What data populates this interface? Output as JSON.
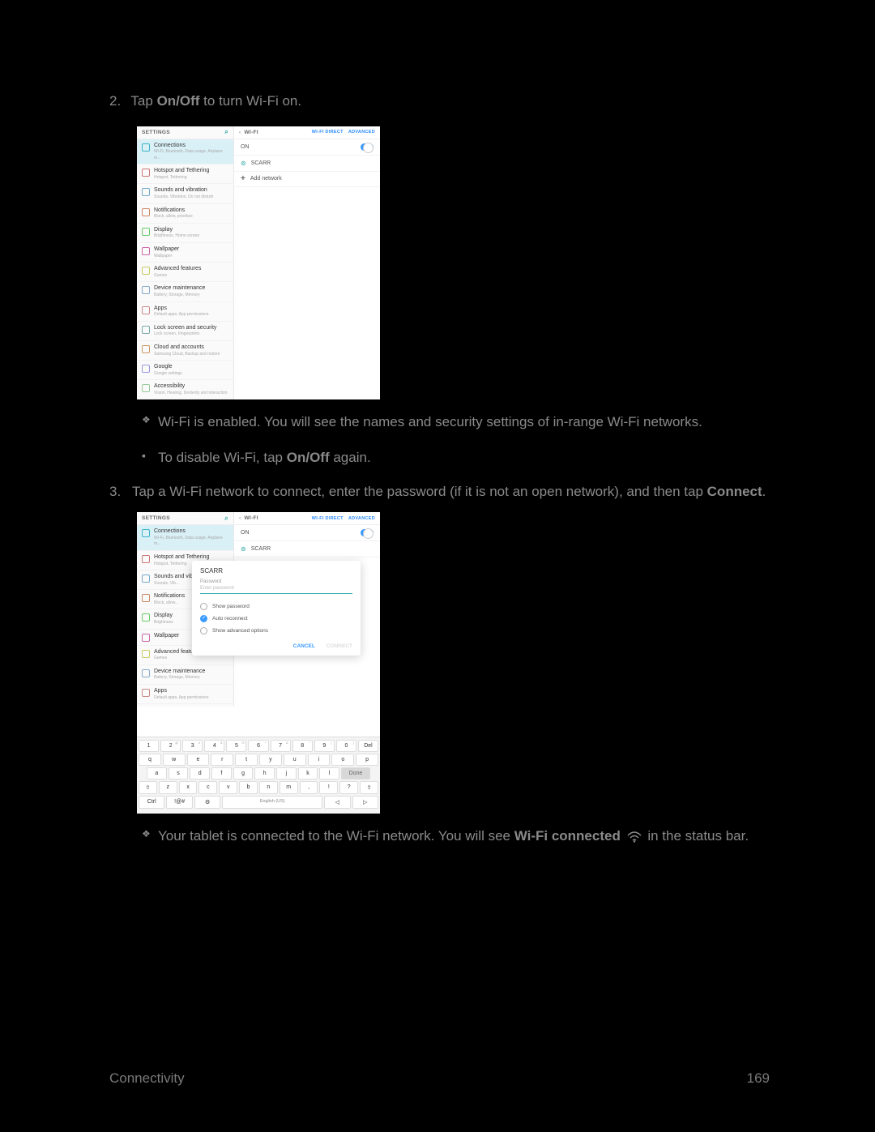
{
  "step2": {
    "num": "2.",
    "pre": "Tap ",
    "bold": "On/Off",
    "post": " to turn Wi-Fi on."
  },
  "bullet1": "Wi-Fi is enabled. You will see the names and security settings of in-range Wi-Fi networks.",
  "bullet2": {
    "pre": "To disable Wi-Fi, tap ",
    "bold": "On/Off",
    "post": " again."
  },
  "step3": {
    "num": "3.",
    "pre": "Tap a Wi-Fi network to connect, enter the password (if it is not an open network), and then tap ",
    "bold": "Connect",
    "post": "."
  },
  "bullet3": {
    "pre": "Your tablet is connected to the Wi-Fi network. You will see ",
    "bold": "Wi-Fi connected",
    "post": " in the status bar."
  },
  "footer": {
    "left": "Connectivity",
    "right": "169"
  },
  "shot": {
    "leftHeader": "SETTINGS",
    "rightHeader": {
      "back": "‹",
      "title": "WI-FI",
      "direct": "Wi-Fi Direct",
      "adv": "ADVANCED"
    },
    "items": [
      {
        "t": "Connections",
        "d": "Wi-Fi, Bluetooth, Data usage, Airplane m...",
        "c": "c-conn",
        "active": true
      },
      {
        "t": "Hotspot and Tethering",
        "d": "Hotspot, Tethering",
        "c": "c-hot"
      },
      {
        "t": "Sounds and vibration",
        "d": "Sounds, Vibration, Do not disturb",
        "c": "c-snd"
      },
      {
        "t": "Notifications",
        "d": "Block, allow, prioritize",
        "c": "c-not"
      },
      {
        "t": "Display",
        "d": "Brightness, Home screen",
        "c": "c-dsp"
      },
      {
        "t": "Wallpaper",
        "d": "Wallpaper",
        "c": "c-wal"
      },
      {
        "t": "Advanced features",
        "d": "Games",
        "c": "c-adv"
      },
      {
        "t": "Device maintenance",
        "d": "Battery, Storage, Memory",
        "c": "c-dev"
      },
      {
        "t": "Apps",
        "d": "Default apps, App permissions",
        "c": "c-app"
      },
      {
        "t": "Lock screen and security",
        "d": "Lock screen, Fingerprints",
        "c": "c-lck"
      },
      {
        "t": "Cloud and accounts",
        "d": "Samsung Cloud, Backup and restore",
        "c": "c-cld"
      },
      {
        "t": "Google",
        "d": "Google settings",
        "c": "c-ggl"
      },
      {
        "t": "Accessibility",
        "d": "Vision, Hearing, Dexterity and interaction",
        "c": "c-acc"
      }
    ],
    "on": "ON",
    "net": "SCARR",
    "add": "Add network"
  },
  "shot2items": [
    {
      "t": "Connections",
      "d": "Wi-Fi, Bluetooth, Data usage, Airplane m...",
      "c": "c-conn",
      "active": true
    },
    {
      "t": "Hotspot and Tethering",
      "d": "Hotspot, Tethering",
      "c": "c-hot"
    },
    {
      "t": "Sounds and vibration",
      "d": "Sounds, Vib...",
      "c": "c-snd"
    },
    {
      "t": "Notifications",
      "d": "Block, allow...",
      "c": "c-not"
    },
    {
      "t": "Display",
      "d": "Brightness",
      "c": "c-dsp"
    },
    {
      "t": "Wallpaper",
      "d": "",
      "c": "c-wal"
    },
    {
      "t": "Advanced features",
      "d": "Games",
      "c": "c-adv"
    },
    {
      "t": "Device maintenance",
      "d": "Battery, Storage, Memory",
      "c": "c-dev"
    },
    {
      "t": "Apps",
      "d": "Default apps, App permissions",
      "c": "c-app"
    }
  ],
  "modal": {
    "title": "SCARR",
    "pwdLabel": "Password",
    "placeholder": "Enter password",
    "showPwd": "Show password",
    "autoReconnect": "Auto reconnect",
    "showAdv": "Show advanced options",
    "cancel": "CANCEL",
    "connect": "CONNECT"
  },
  "kbd": {
    "r1": [
      [
        "1",
        ""
      ],
      [
        "2",
        "@"
      ],
      [
        "3",
        "#"
      ],
      [
        "4",
        "$"
      ],
      [
        "5",
        "%"
      ],
      [
        "6",
        "^"
      ],
      [
        "7",
        "&"
      ],
      [
        "8",
        "*"
      ],
      [
        "9",
        "("
      ],
      [
        "0",
        ")"
      ],
      [
        "Del",
        ""
      ]
    ],
    "r2": [
      "q",
      "w",
      "e",
      "r",
      "t",
      "y",
      "u",
      "i",
      "o",
      "p"
    ],
    "r3": [
      "a",
      "s",
      "d",
      "f",
      "g",
      "h",
      "j",
      "k",
      "l"
    ],
    "done": "Done",
    "r4": [
      "⇧",
      "z",
      "x",
      "c",
      "v",
      "b",
      "n",
      "m",
      ",",
      "!",
      "?",
      "⇧"
    ],
    "r5pre": [
      "Ctrl",
      "!@#",
      "⚙"
    ],
    "space": "English (US)",
    "r5post": [
      "◁",
      "▷"
    ]
  }
}
